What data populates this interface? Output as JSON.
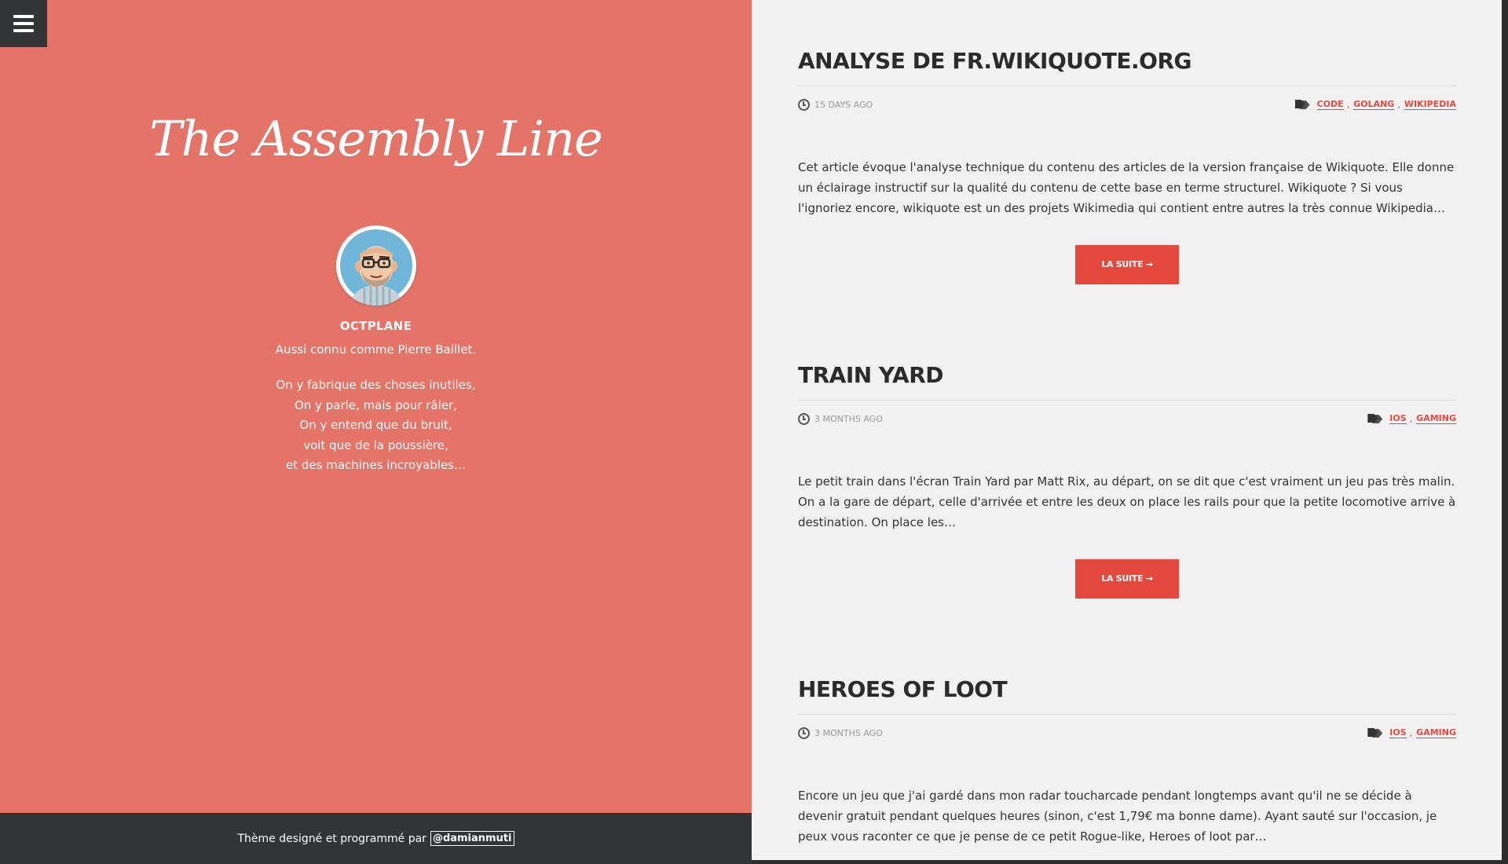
{
  "sidebar": {
    "site_title": "The Assembly Line",
    "author_name": "OCTPLANE",
    "author_aka": "Aussi connu comme Pierre Baillet.",
    "description_lines": [
      "On y fabrique des choses inutiles,",
      "On y parle, mais pour râler,",
      "On y entend que du bruit,",
      "voit que de la poussière,",
      "et des machines incroyables…"
    ],
    "footer_text": "Thème designé et programmé par",
    "footer_link": "@damianmuti"
  },
  "posts": [
    {
      "title": "ANALYSE DE FR.WIKIQUOTE.ORG",
      "date": "15 DAYS AGO",
      "tags": [
        "CODE",
        "GOLANG",
        "WIKIPEDIA"
      ],
      "excerpt": "Cet article évoque l'analyse technique du contenu des articles de la version française de Wikiquote. Elle donne un éclairage instructif sur la qualité du contenu de cette base en terme structurel. Wikiquote ? Si vous l'ignoriez encore, wikiquote est un des projets Wikimedia qui contient entre autres la très connue Wikipedia…",
      "read_more": "LA SUITE →"
    },
    {
      "title": "TRAIN YARD",
      "date": "3 MONTHS AGO",
      "tags": [
        "IOS",
        "GAMING"
      ],
      "excerpt": "Le petit train dans l'écran Train Yard par Matt Rix, au départ, on se dit que c'est vraiment un jeu pas très malin. On a la gare de départ, celle d'arrivée et entre les deux on place les rails pour que la petite locomotive arrive à destination. On place les…",
      "read_more": "LA SUITE →"
    },
    {
      "title": "HEROES OF LOOT",
      "date": "3 MONTHS AGO",
      "tags": [
        "IOS",
        "GAMING"
      ],
      "excerpt": "Encore un jeu que j'ai gardé dans mon radar toucharcade pendant longtemps avant qu'il ne se décide à devenir gratuit pendant quelques heures (sinon, c'est 1,79€ ma bonne dame). Ayant sauté sur l'occasion, je peux vous raconter ce que je pense de ce petit Rogue-like, Heroes of loot par…"
    }
  ],
  "colors": {
    "sidebar_bg": "#e47467",
    "accent": "#e34a3d",
    "dark": "#333436",
    "content_bg": "#f1f1f1"
  }
}
